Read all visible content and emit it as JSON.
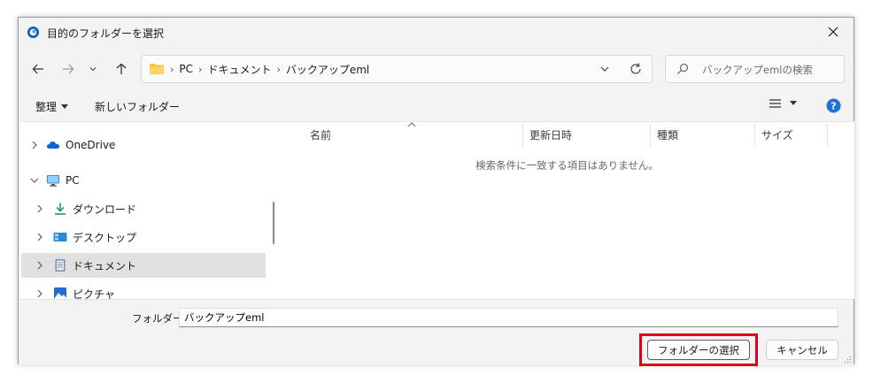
{
  "window": {
    "title": "目的のフォルダーを選択"
  },
  "address": {
    "crumbs": [
      "PC",
      "ドキュメント",
      "バックアップeml"
    ]
  },
  "search": {
    "placeholder": "バックアップemlの検索"
  },
  "toolbar": {
    "organize": "整理",
    "new_folder": "新しいフォルダー"
  },
  "nav": {
    "items": [
      {
        "label": "OneDrive"
      },
      {
        "label": "PC"
      },
      {
        "label": "ダウンロード"
      },
      {
        "label": "デスクトップ"
      },
      {
        "label": "ドキュメント"
      },
      {
        "label": "ピクチャ"
      }
    ]
  },
  "file_list": {
    "columns": [
      "名前",
      "更新日時",
      "種類",
      "サイズ"
    ],
    "empty_message": "検索条件に一致する項目はありません。"
  },
  "footer": {
    "folder_label": "フォルダー:",
    "folder_value": "バックアップeml",
    "select_button": "フォルダーの選択",
    "cancel_button": "キャンセル"
  },
  "colors": {
    "highlight": "#e0001b",
    "folder_yellow": "#f8c33d",
    "onedrive_blue": "#0a64d6",
    "help_blue": "#1f73d8"
  }
}
